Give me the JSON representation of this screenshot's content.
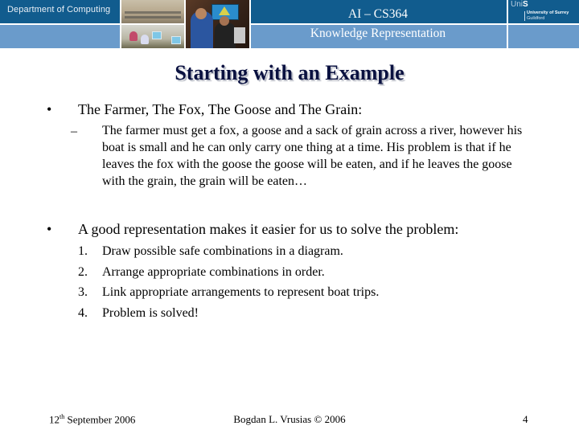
{
  "header": {
    "department": "Department of Computing",
    "course_code": "AI – CS364",
    "course_title": "Knowledge Representation",
    "logo": {
      "brand_prefix": "Uni",
      "brand_suffix": "S",
      "line1": "University of Surrey",
      "line2": "Guildford"
    },
    "colors": {
      "dark_band": "#115c8e",
      "light_band": "#6a9bcb"
    }
  },
  "slide": {
    "title": "Starting with an Example",
    "bullets": [
      {
        "marker": "•",
        "text": "The Farmer, The Fox, The Goose and The Grain:",
        "sub": {
          "marker": "–",
          "text": "The farmer must get a fox, a goose and a sack of grain across a river, however his boat is small and he can only carry one thing at a time. His problem is that if he leaves the fox with the goose the goose will be eaten, and if he leaves the goose with the grain, the grain will be eaten…"
        }
      },
      {
        "marker": "•",
        "text": "A good representation makes it easier for us to solve the problem:",
        "steps": [
          {
            "num": "1.",
            "text": "Draw possible safe combinations in a diagram."
          },
          {
            "num": "2.",
            "text": "Arrange appropriate combinations in order."
          },
          {
            "num": "3.",
            "text": "Link appropriate arrangements to represent boat trips."
          },
          {
            "num": "4.",
            "text": "Problem is solved!"
          }
        ]
      }
    ]
  },
  "footer": {
    "date_day": "12",
    "date_suffix": "th",
    "date_rest": " September 2006",
    "author": "Bogdan L. Vrusias © 2006",
    "page_number": "4"
  }
}
